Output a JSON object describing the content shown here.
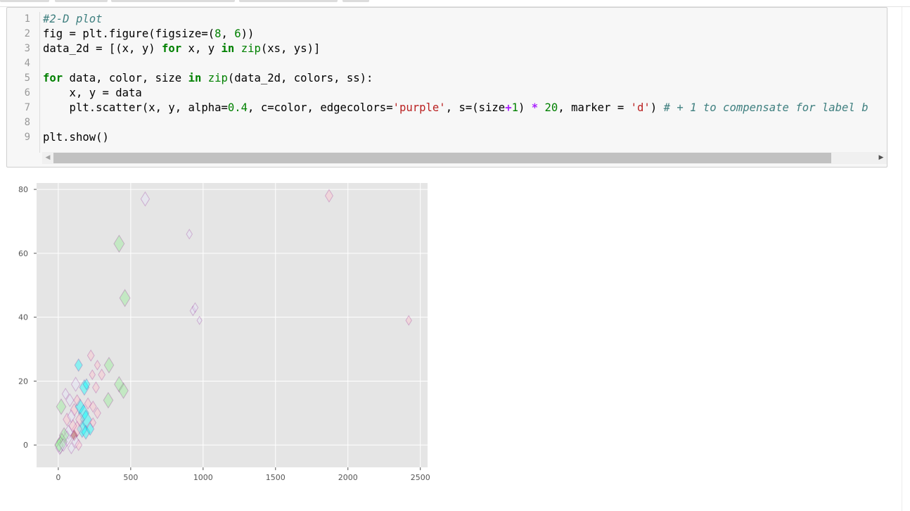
{
  "code_cell": {
    "line_numbers": [
      "1",
      "2",
      "3",
      "4",
      "5",
      "6",
      "7",
      "8",
      "9"
    ],
    "lines": [
      [
        {
          "t": "cm",
          "s": "#2-D plot"
        }
      ],
      [
        {
          "t": "plain",
          "s": "fig = plt.figure(figsize=("
        },
        {
          "t": "num",
          "s": "8"
        },
        {
          "t": "plain",
          "s": ", "
        },
        {
          "t": "num",
          "s": "6"
        },
        {
          "t": "plain",
          "s": "))"
        }
      ],
      [
        {
          "t": "plain",
          "s": "data_2d = [(x, y) "
        },
        {
          "t": "kw",
          "s": "for"
        },
        {
          "t": "plain",
          "s": " x, y "
        },
        {
          "t": "kw",
          "s": "in"
        },
        {
          "t": "plain",
          "s": " "
        },
        {
          "t": "bi",
          "s": "zip"
        },
        {
          "t": "plain",
          "s": "(xs, ys)]"
        }
      ],
      [],
      [
        {
          "t": "kw",
          "s": "for"
        },
        {
          "t": "plain",
          "s": " data, color, size "
        },
        {
          "t": "kw",
          "s": "in"
        },
        {
          "t": "plain",
          "s": " "
        },
        {
          "t": "bi",
          "s": "zip"
        },
        {
          "t": "plain",
          "s": "(data_2d, colors, ss):"
        }
      ],
      [
        {
          "t": "plain",
          "s": "    x, y = data"
        }
      ],
      [
        {
          "t": "plain",
          "s": "    plt.scatter(x, y, alpha="
        },
        {
          "t": "num",
          "s": "0.4"
        },
        {
          "t": "plain",
          "s": ", c=color, edgecolors="
        },
        {
          "t": "str",
          "s": "'purple'"
        },
        {
          "t": "plain",
          "s": ", s=(size"
        },
        {
          "t": "op",
          "s": "+"
        },
        {
          "t": "num",
          "s": "1"
        },
        {
          "t": "plain",
          "s": ") "
        },
        {
          "t": "op",
          "s": "*"
        },
        {
          "t": "plain",
          "s": " "
        },
        {
          "t": "num",
          "s": "20"
        },
        {
          "t": "plain",
          "s": ", marker = "
        },
        {
          "t": "str",
          "s": "'d'"
        },
        {
          "t": "plain",
          "s": ") "
        },
        {
          "t": "cm",
          "s": "# + 1 to compensate for label b"
        }
      ],
      [],
      [
        {
          "t": "plain",
          "s": "plt.show()"
        }
      ]
    ]
  },
  "scrollbar": {
    "left_arrow": "◀",
    "right_arrow": "▶"
  },
  "chart_data": {
    "type": "scatter",
    "marker": "diamond",
    "xlim": [
      -150,
      2550
    ],
    "ylim": [
      -7,
      82
    ],
    "x_ticks": [
      0,
      500,
      1000,
      1500,
      2000,
      2500
    ],
    "y_ticks": [
      0,
      20,
      40,
      60,
      80
    ],
    "grid": true,
    "background": "#e5e5e5",
    "edge_color": "#800080",
    "alpha": 0.4,
    "colors": {
      "green": "#90ee90",
      "cyan": "#00ffff",
      "pink": "#ffc0cb",
      "lavender": "#e6e6fa",
      "brown": "#a52a2a"
    },
    "points": [
      {
        "x": 600,
        "y": 77,
        "c": "lavender",
        "s": 7
      },
      {
        "x": 1870,
        "y": 78,
        "c": "pink",
        "s": 6
      },
      {
        "x": 905,
        "y": 66,
        "c": "lavender",
        "s": 4
      },
      {
        "x": 420,
        "y": 63,
        "c": "green",
        "s": 9
      },
      {
        "x": 460,
        "y": 46,
        "c": "green",
        "s": 9
      },
      {
        "x": 930,
        "y": 42,
        "c": "lavender",
        "s": 4
      },
      {
        "x": 945,
        "y": 43,
        "c": "lavender",
        "s": 4
      },
      {
        "x": 975,
        "y": 39,
        "c": "lavender",
        "s": 3
      },
      {
        "x": 2420,
        "y": 39,
        "c": "pink",
        "s": 4
      },
      {
        "x": 225,
        "y": 28,
        "c": "pink",
        "s": 5
      },
      {
        "x": 350,
        "y": 25,
        "c": "green",
        "s": 8
      },
      {
        "x": 140,
        "y": 25,
        "c": "cyan",
        "s": 6
      },
      {
        "x": 270,
        "y": 25,
        "c": "pink",
        "s": 4
      },
      {
        "x": 300,
        "y": 22,
        "c": "pink",
        "s": 5
      },
      {
        "x": 235,
        "y": 22,
        "c": "pink",
        "s": 4
      },
      {
        "x": 420,
        "y": 19,
        "c": "green",
        "s": 8
      },
      {
        "x": 450,
        "y": 17,
        "c": "green",
        "s": 8
      },
      {
        "x": 50,
        "y": 16,
        "c": "lavender",
        "s": 5
      },
      {
        "x": 120,
        "y": 19,
        "c": "lavender",
        "s": 7
      },
      {
        "x": 180,
        "y": 18,
        "c": "cyan",
        "s": 8
      },
      {
        "x": 195,
        "y": 19,
        "c": "cyan",
        "s": 5
      },
      {
        "x": 260,
        "y": 18,
        "c": "pink",
        "s": 5
      },
      {
        "x": 345,
        "y": 14,
        "c": "green",
        "s": 8
      },
      {
        "x": 20,
        "y": 12,
        "c": "green",
        "s": 8
      },
      {
        "x": 80,
        "y": 14,
        "c": "lavender",
        "s": 6
      },
      {
        "x": 110,
        "y": 11,
        "c": "pink",
        "s": 6
      },
      {
        "x": 150,
        "y": 12,
        "c": "cyan",
        "s": 8
      },
      {
        "x": 175,
        "y": 10,
        "c": "cyan",
        "s": 9
      },
      {
        "x": 190,
        "y": 8,
        "c": "cyan",
        "s": 10
      },
      {
        "x": 205,
        "y": 13,
        "c": "pink",
        "s": 5
      },
      {
        "x": 240,
        "y": 12,
        "c": "pink",
        "s": 5
      },
      {
        "x": 270,
        "y": 10,
        "c": "pink",
        "s": 5
      },
      {
        "x": 240,
        "y": 7,
        "c": "pink",
        "s": 4
      },
      {
        "x": 165,
        "y": 5,
        "c": "cyan",
        "s": 9
      },
      {
        "x": 190,
        "y": 4,
        "c": "cyan",
        "s": 7
      },
      {
        "x": 220,
        "y": 5,
        "c": "cyan",
        "s": 6
      },
      {
        "x": 130,
        "y": 5,
        "c": "pink",
        "s": 8
      },
      {
        "x": 110,
        "y": 3,
        "c": "brown",
        "s": 5
      },
      {
        "x": 70,
        "y": 4,
        "c": "lavender",
        "s": 7
      },
      {
        "x": 100,
        "y": 6,
        "c": "pink",
        "s": 6
      },
      {
        "x": 60,
        "y": 2,
        "c": "lavender",
        "s": 8
      },
      {
        "x": 40,
        "y": 3,
        "c": "green",
        "s": 8
      },
      {
        "x": 25,
        "y": 1,
        "c": "green",
        "s": 9
      },
      {
        "x": 15,
        "y": 0,
        "c": "green",
        "s": 9
      },
      {
        "x": 10,
        "y": -1,
        "c": "lavender",
        "s": 6
      },
      {
        "x": 5,
        "y": 0,
        "c": "green",
        "s": 7
      },
      {
        "x": 35,
        "y": 0,
        "c": "lavender",
        "s": 6
      },
      {
        "x": 120,
        "y": 1,
        "c": "lavender",
        "s": 6
      },
      {
        "x": 140,
        "y": 0,
        "c": "pink",
        "s": 5
      },
      {
        "x": 90,
        "y": -1,
        "c": "lavender",
        "s": 5
      },
      {
        "x": 150,
        "y": 8,
        "c": "pink",
        "s": 7
      },
      {
        "x": 130,
        "y": 14,
        "c": "pink",
        "s": 5
      },
      {
        "x": 60,
        "y": 8,
        "c": "pink",
        "s": 6
      },
      {
        "x": 90,
        "y": 9,
        "c": "lavender",
        "s": 6
      }
    ]
  }
}
